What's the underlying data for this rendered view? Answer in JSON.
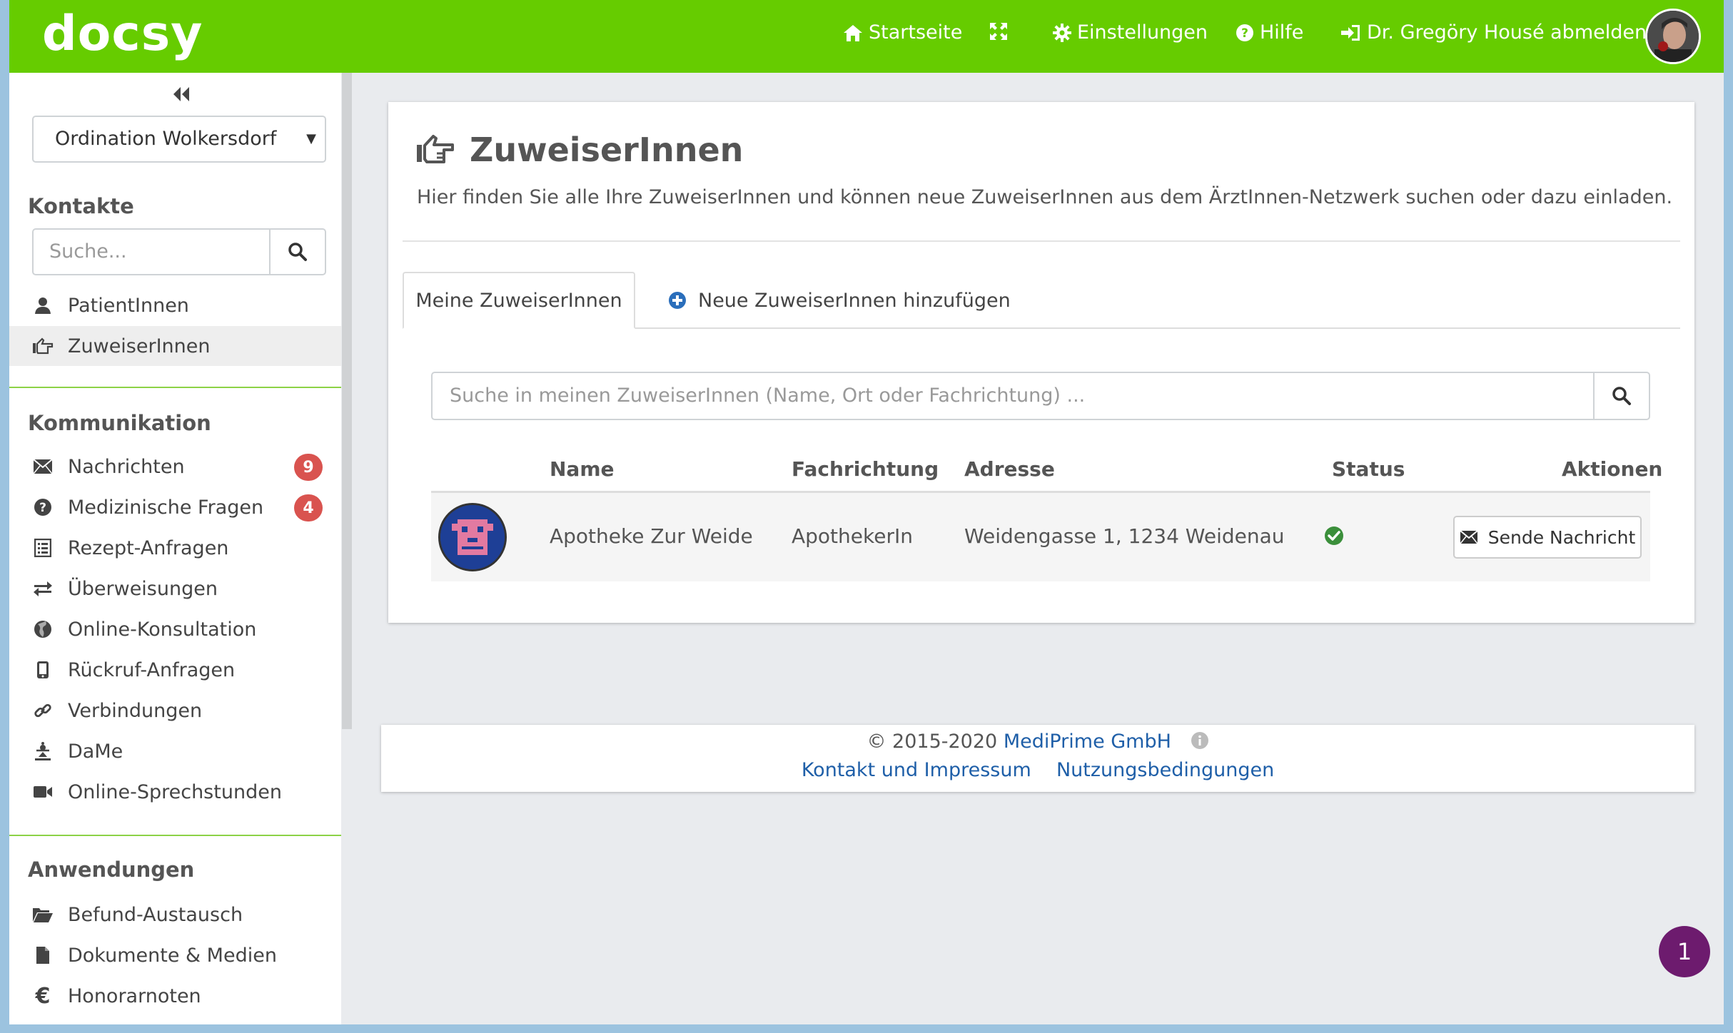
{
  "header": {
    "logo": "docsy",
    "nav": {
      "home": "Startseite",
      "settings": "Einstellungen",
      "help": "Hilfe",
      "logout": "Dr. Gregöry Housé abmelden"
    }
  },
  "sidebar": {
    "location_select": "Ordination Wolkersdorf",
    "sections": {
      "contacts": "Kontakte",
      "communication": "Kommunikation",
      "applications": "Anwendungen"
    },
    "search_placeholder": "Suche...",
    "contacts_items": [
      {
        "label": "PatientInnen",
        "icon": "user-icon"
      },
      {
        "label": "ZuweiserInnen",
        "icon": "hand-pointing-icon"
      }
    ],
    "communication_items": [
      {
        "label": "Nachrichten",
        "icon": "envelope-icon",
        "badge": "9"
      },
      {
        "label": "Medizinische Fragen",
        "icon": "question-circle-icon",
        "badge": "4"
      },
      {
        "label": "Rezept-Anfragen",
        "icon": "list-icon"
      },
      {
        "label": "Überweisungen",
        "icon": "transfer-icon"
      },
      {
        "label": "Online-Konsultation",
        "icon": "globe-icon"
      },
      {
        "label": "Rückruf-Anfragen",
        "icon": "phone-icon"
      },
      {
        "label": "Verbindungen",
        "icon": "link-icon"
      },
      {
        "label": "DaMe",
        "icon": "dame-icon"
      },
      {
        "label": "Online-Sprechstunden",
        "icon": "video-icon"
      }
    ],
    "applications_items": [
      {
        "label": "Befund-Austausch",
        "icon": "folder-open-icon"
      },
      {
        "label": "Dokumente & Medien",
        "icon": "file-icon"
      },
      {
        "label": "Honorarnoten",
        "icon": "euro-icon"
      }
    ]
  },
  "main": {
    "title": "ZuweiserInnen",
    "intro": "Hier finden Sie alle Ihre ZuweiserInnen und können neue ZuweiserInnen aus dem ÄrztInnen-Netzwerk suchen oder dazu einladen.",
    "tabs": {
      "mine": "Meine ZuweiserInnen",
      "add": "Neue ZuweiserInnen hinzufügen"
    },
    "search_placeholder": "Suche in meinen ZuweiserInnen (Name, Ort oder Fachrichtung) ...",
    "table": {
      "headers": {
        "name": "Name",
        "specialty": "Fachrichtung",
        "address": "Adresse",
        "status": "Status",
        "actions": "Aktionen"
      },
      "rows": [
        {
          "name": "Apotheke Zur Weide",
          "specialty": "ApothekerIn",
          "address": "Weidengasse 1, 1234 Weidenau",
          "status": "active",
          "action": "Sende Nachricht"
        }
      ]
    }
  },
  "footer": {
    "copyright": "© 2015-2020 ",
    "company": "MediPrime GmbH",
    "contact": "Kontakt und Impressum",
    "terms": "Nutzungsbedingungen"
  },
  "chat": {
    "count": "1"
  },
  "colors": {
    "brand_green": "#66cc00",
    "badge_red": "#d9534f",
    "link_blue": "#1f5fa8"
  }
}
